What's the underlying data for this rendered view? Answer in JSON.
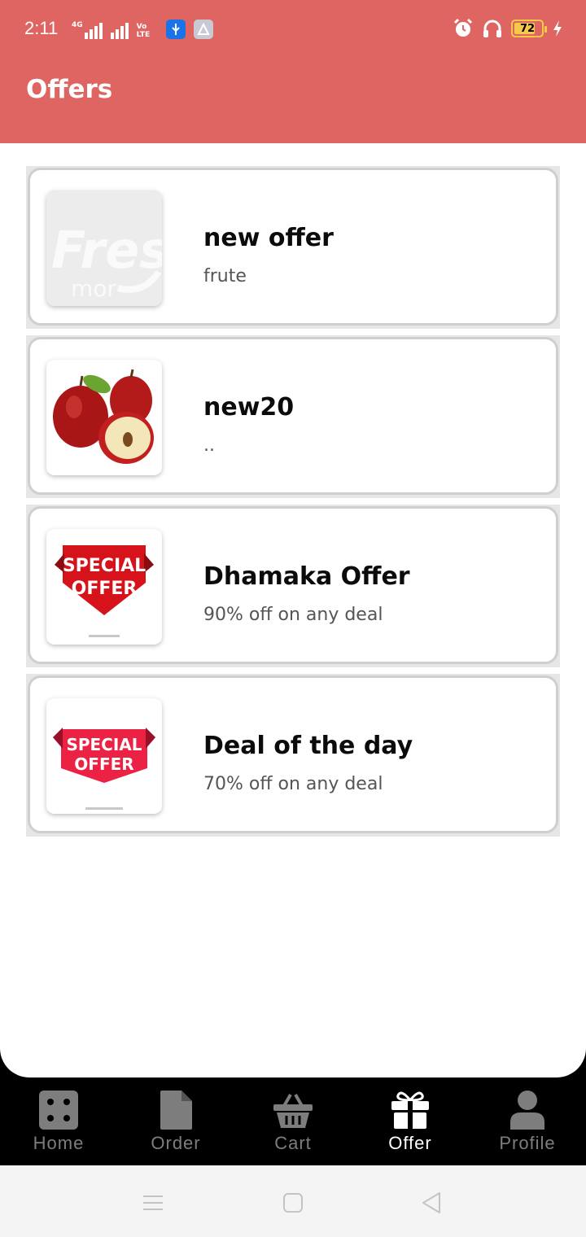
{
  "status_bar": {
    "time": "2:11",
    "network_tag": "4G",
    "volte_tag": "Vo LTE",
    "battery_level": "72",
    "icons": [
      "signal-icon",
      "signal-icon",
      "volte-icon",
      "usb-icon",
      "app-notification-icon",
      "alarm-icon",
      "headphones-icon",
      "battery-icon",
      "charging-icon"
    ]
  },
  "header": {
    "title": "Offers",
    "background_color": "#df6562"
  },
  "offers": [
    {
      "title": "new offer",
      "description": "frute",
      "image": "freshmor-logo"
    },
    {
      "title": "new20",
      "description": "..",
      "image": "apples-photo"
    },
    {
      "title": "Dhamaka Offer",
      "description": "90% off on any deal",
      "image": "special-offer-banner"
    },
    {
      "title": "Deal of the day",
      "description": "70% off on any deal",
      "image": "special-offer-banner"
    }
  ],
  "offer_images": {
    "freshmor_line1": "Fresh",
    "freshmor_line2": "mor",
    "special_line1": "SPECIAL",
    "special_line2": "OFFER"
  },
  "bottom_nav": {
    "items": [
      {
        "label": "Home",
        "icon": "dashboard-icon",
        "active": false
      },
      {
        "label": "Order",
        "icon": "document-icon",
        "active": false
      },
      {
        "label": "Cart",
        "icon": "basket-icon",
        "active": false
      },
      {
        "label": "Offer",
        "icon": "gift-icon",
        "active": true
      },
      {
        "label": "Profile",
        "icon": "person-icon",
        "active": false
      }
    ]
  },
  "system_nav": {
    "icons": [
      "menu-icon",
      "home-square-icon",
      "back-triangle-icon"
    ]
  }
}
